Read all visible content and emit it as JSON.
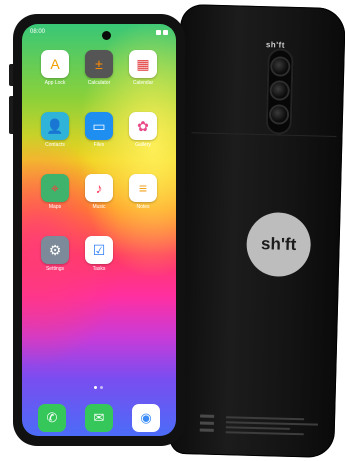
{
  "back": {
    "brand_top": "sh'ft",
    "logo_text": "sh'ft"
  },
  "status": {
    "time": "08:00"
  },
  "apps": [
    {
      "label": "App Lock",
      "icon": "app-lock-icon",
      "glyph": "A",
      "color": "#ffffff",
      "fg": "#f0a000"
    },
    {
      "label": "Calculator",
      "icon": "calculator-icon",
      "glyph": "±",
      "color": "#555555",
      "fg": "#ff8a00"
    },
    {
      "label": "Calendar",
      "icon": "calendar-icon",
      "glyph": "▦",
      "color": "#ffffff",
      "fg": "#e23b3b"
    },
    {
      "label": "Contacts",
      "icon": "contacts-icon",
      "glyph": "👤",
      "color": "#2fb3d8",
      "fg": "#ffffff"
    },
    {
      "label": "Files",
      "icon": "files-icon",
      "glyph": "▭",
      "color": "#1e8ef0",
      "fg": "#ffffff"
    },
    {
      "label": "Gallery",
      "icon": "gallery-icon",
      "glyph": "✿",
      "color": "#ffffff",
      "fg": "#e84a8a"
    },
    {
      "label": "Maps",
      "icon": "maps-icon",
      "glyph": "⌖",
      "color": "#3fb36b",
      "fg": "#ff3b3b"
    },
    {
      "label": "Music",
      "icon": "music-icon",
      "glyph": "♪",
      "color": "#ffffff",
      "fg": "#ff3b5c"
    },
    {
      "label": "Notes",
      "icon": "notes-icon",
      "glyph": "≡",
      "color": "#ffffff",
      "fg": "#f2a21b"
    },
    {
      "label": "Settings",
      "icon": "settings-icon",
      "glyph": "⚙",
      "color": "#7c8a99",
      "fg": "#ffffff"
    },
    {
      "label": "Tasks",
      "icon": "tasks-icon",
      "glyph": "☑",
      "color": "#ffffff",
      "fg": "#2d7ef7"
    }
  ],
  "dock": [
    {
      "icon": "phone-icon",
      "glyph": "✆",
      "color": "#35c759"
    },
    {
      "icon": "messages-icon",
      "glyph": "✉",
      "color": "#35c759"
    },
    {
      "icon": "browser-icon",
      "glyph": "◉",
      "color": "#ffffff"
    }
  ]
}
